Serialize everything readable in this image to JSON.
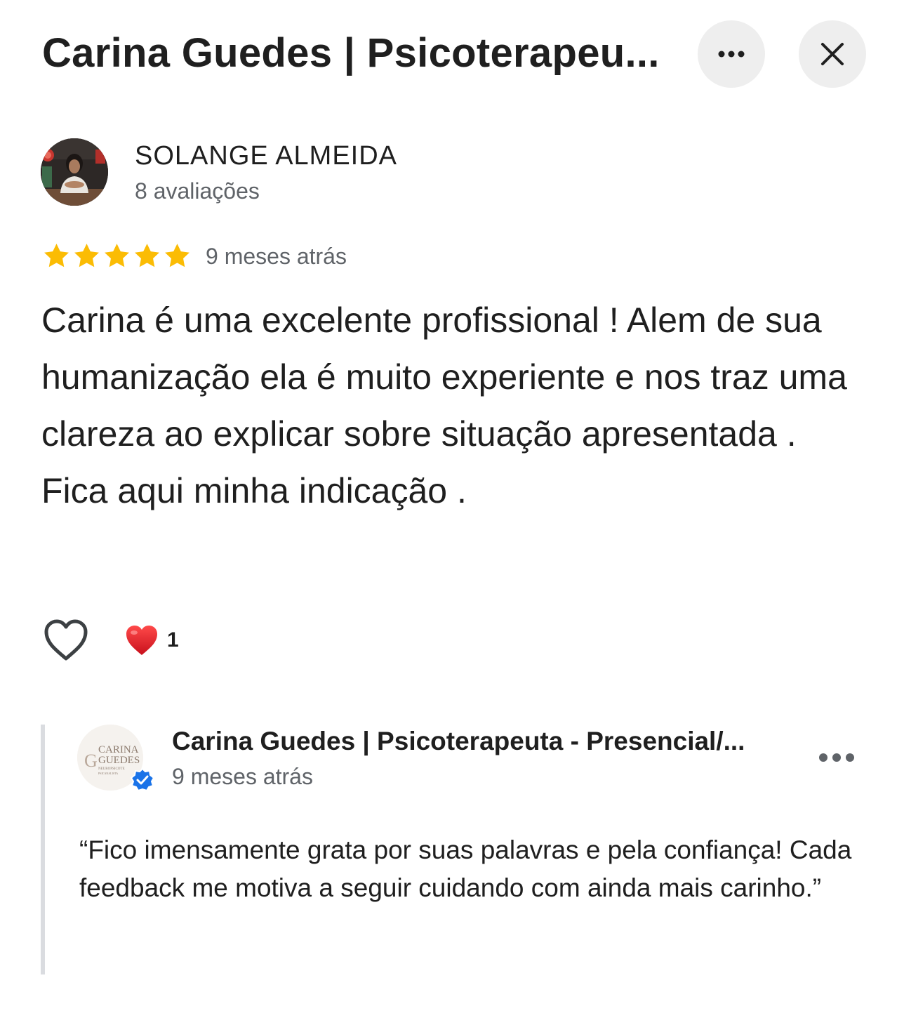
{
  "header": {
    "title": "Carina Guedes | Psicoterapeu...",
    "more_icon": "more-horiz-icon",
    "close_icon": "close-icon"
  },
  "review": {
    "reviewer_name": "SOLANGE ALMEIDA",
    "reviewer_meta": "8 avaliações",
    "rating": 5,
    "rating_max": 5,
    "date": "9 meses atrás",
    "text": "Carina é uma excelente profissional ! Alem de sua humanização ela é muito experiente e nos traz uma clareza ao explicar sobre situação apresentada . Fica aqui minha indicação .",
    "reaction_count": "1",
    "star_color": "#fbbc04",
    "heart_color": "#e0202b"
  },
  "owner_reply": {
    "name": "Carina Guedes | Psicoterapeuta - Presencial/...",
    "date": "9 meses atrás",
    "text": "“Fico imensamente grata por suas palavras e pela confiança! Cada feedback me motiva a seguir cuidando com ainda mais carinho.”",
    "logo_line1": "CARINA",
    "logo_line2": "GUEDES",
    "logo_line3": "NEUROPSICOTE",
    "logo_line4": "PSICANALISTA",
    "verified_color": "#1a73e8"
  }
}
